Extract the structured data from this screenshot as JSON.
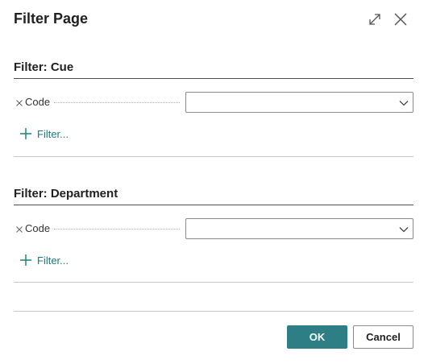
{
  "dialog": {
    "title": "Filter Page",
    "expand_icon": "expand-icon",
    "close_icon": "close-icon"
  },
  "sections": [
    {
      "title": "Filter: Cue",
      "field_label": "Code",
      "field_value": "",
      "add_filter_label": "Filter..."
    },
    {
      "title": "Filter: Department",
      "field_label": "Code",
      "field_value": "",
      "add_filter_label": "Filter..."
    }
  ],
  "footer": {
    "ok_label": "OK",
    "cancel_label": "Cancel"
  },
  "colors": {
    "primary": "#2d7f85",
    "link": "#1b7b7e"
  }
}
